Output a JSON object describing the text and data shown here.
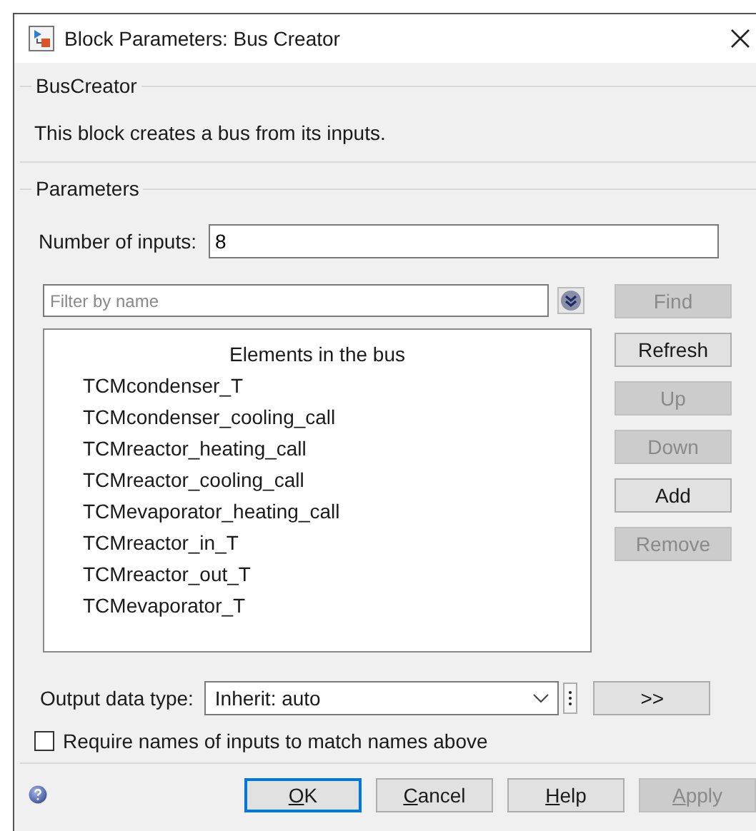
{
  "window": {
    "title": "Block Parameters: Bus Creator"
  },
  "block_group": {
    "title": "BusCreator",
    "description": "This block creates a bus from its inputs."
  },
  "parameters_group": {
    "title": "Parameters",
    "number_of_inputs": {
      "label": "Number of inputs:",
      "value": "8"
    },
    "filter": {
      "placeholder": "Filter by name"
    },
    "elements_list": {
      "heading": "Elements in the bus",
      "items": [
        {
          "label": "TCMcondenser_T",
          "selected": false
        },
        {
          "label": "TCMcondenser_cooling_call",
          "selected": false
        },
        {
          "label": "TCMreactor_heating_call",
          "selected": false
        },
        {
          "label": "TCMreactor_cooling_call",
          "selected": false
        },
        {
          "label": "TCMevaporator_heating_call",
          "selected": false
        },
        {
          "label": "TCMreactor_in_T",
          "selected": false
        },
        {
          "label": "TCMreactor_out_T",
          "selected": false
        },
        {
          "label": "TCMevaporator_T",
          "selected": false
        }
      ]
    },
    "side_buttons": [
      {
        "label": "Find",
        "disabled": true
      },
      {
        "label": "Refresh",
        "disabled": false
      },
      {
        "label": "Up",
        "disabled": true
      },
      {
        "label": "Down",
        "disabled": true
      },
      {
        "label": "Add",
        "disabled": false
      },
      {
        "label": "Remove",
        "disabled": true
      }
    ],
    "output_data_type": {
      "label": "Output data type:",
      "value": "Inherit: auto",
      "assistant_button": ">>"
    },
    "require_names": {
      "label": "Require names of inputs to match names above",
      "checked": false
    }
  },
  "footer_buttons": [
    {
      "label": "OK",
      "mnemonic": true,
      "disabled": false,
      "focused": true
    },
    {
      "label": "Cancel",
      "mnemonic": true,
      "disabled": false,
      "focused": false
    },
    {
      "label": "Help",
      "mnemonic": true,
      "disabled": false,
      "focused": false
    },
    {
      "label": "Apply",
      "mnemonic": true,
      "disabled": true,
      "focused": false
    }
  ]
}
